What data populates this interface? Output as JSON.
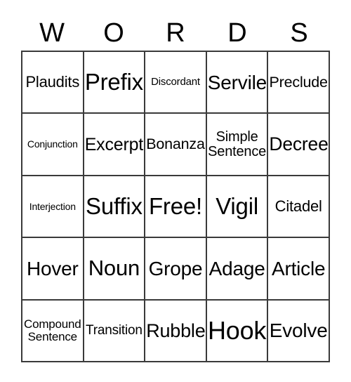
{
  "card": {
    "title_letters": [
      "W",
      "O",
      "R",
      "D",
      "S"
    ],
    "free_space_label": "Free!",
    "border_color": "#3a3a3a",
    "background_color": "#ffffff",
    "text_color": "#000000",
    "rows": 5,
    "columns": 5,
    "cells": [
      [
        {
          "text": "Plaudits",
          "size": "l"
        },
        {
          "text": "Prefix",
          "size": "4xl"
        },
        {
          "text": "Discordant",
          "size": "s"
        },
        {
          "text": "Servile",
          "size": "3xl"
        },
        {
          "text": "Preclude",
          "size": "l"
        }
      ],
      [
        {
          "text": "Conjunction",
          "size": "xs"
        },
        {
          "text": "Excerpt",
          "size": "2xl"
        },
        {
          "text": "Bonanza",
          "size": "xl"
        },
        {
          "text": "Simple\nSentence",
          "size": "ml"
        },
        {
          "text": "Decree",
          "size": "3xl"
        }
      ],
      [
        {
          "text": "Interjection",
          "size": "xs"
        },
        {
          "text": "Suffix",
          "size": "4xl"
        },
        {
          "text": "Free!",
          "size": "4xl"
        },
        {
          "text": "Vigil",
          "size": "4xl"
        },
        {
          "text": "Citadel",
          "size": "l"
        }
      ],
      [
        {
          "text": "Hover",
          "size": "2xl"
        },
        {
          "text": "Noun",
          "size": "3xl"
        },
        {
          "text": "Grope",
          "size": "2xl"
        },
        {
          "text": "Adage",
          "size": "2xl"
        },
        {
          "text": "Article",
          "size": "2xl"
        }
      ],
      [
        {
          "text": "Compound\nSentence",
          "size": "sm"
        },
        {
          "text": "Transition",
          "size": "m"
        },
        {
          "text": "Rubble",
          "size": "2xl"
        },
        {
          "text": "Hook",
          "size": "5xl"
        },
        {
          "text": "Evolve",
          "size": "2xl"
        }
      ]
    ]
  }
}
